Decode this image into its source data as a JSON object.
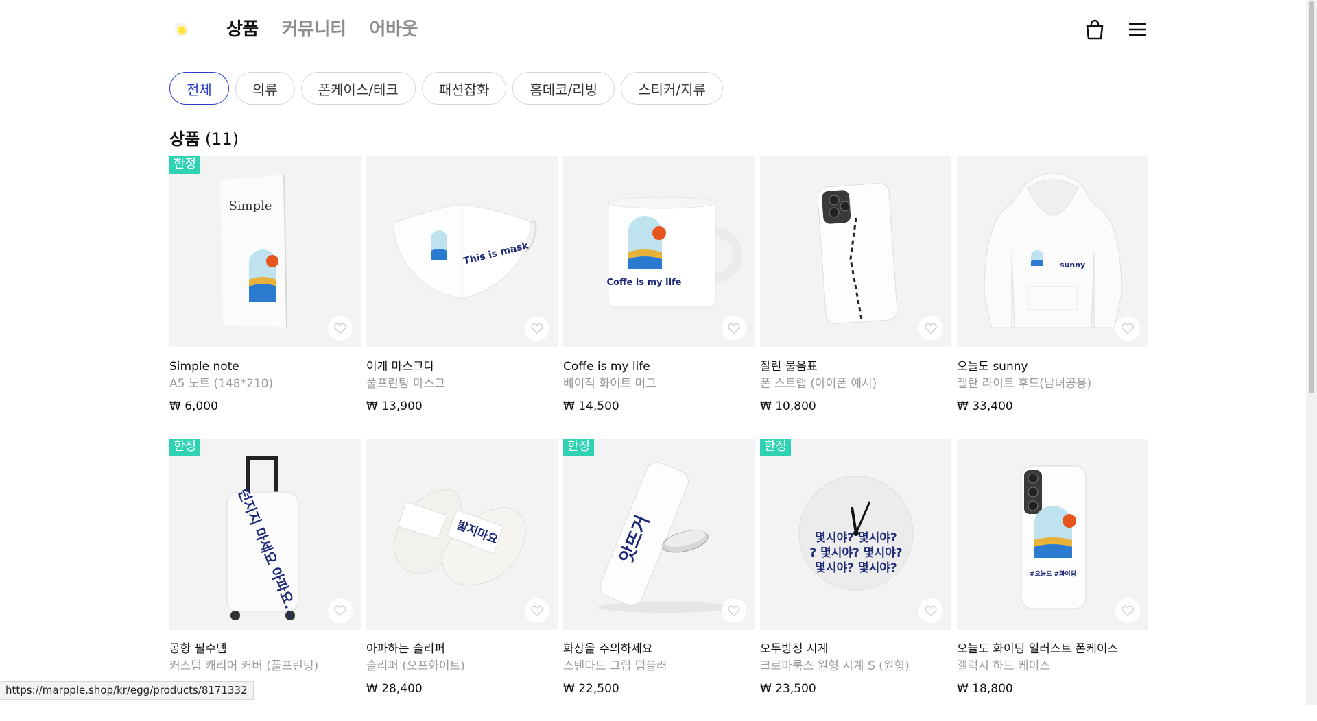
{
  "nav": {
    "items": [
      "상품",
      "커뮤니티",
      "어바웃"
    ],
    "active": "상품"
  },
  "header_icons": [
    "shopping-bag-icon",
    "menu-icon"
  ],
  "categories": [
    "전체",
    "의류",
    "폰케이스/테크",
    "패션잡화",
    "홈데코/리빙",
    "스티커/지류"
  ],
  "active_category": "전체",
  "section": {
    "title": "상품",
    "count": "(11)"
  },
  "products": [
    {
      "badge": "한정",
      "name": "Simple note",
      "sub": "A5 노트 (148*210)",
      "price": "₩ 6,000",
      "art_text": "Simple"
    },
    {
      "badge": "",
      "name": "이게 마스크다",
      "sub": "풀프린팅 마스크",
      "price": "₩ 13,900",
      "art_text": "This is mask"
    },
    {
      "badge": "",
      "name": "Coffe is my life",
      "sub": "베이직 화이트 머그",
      "price": "₩ 14,500",
      "art_text": "Coffe is my life"
    },
    {
      "badge": "",
      "name": "잘린 물음표",
      "sub": "폰 스트랩 (아이폰 예시)",
      "price": "₩ 10,800",
      "art_text": ""
    },
    {
      "badge": "",
      "name": "오늘도 sunny",
      "sub": "젤란 라이트 후드(남녀공용)",
      "price": "₩ 33,400",
      "art_text": "sunny"
    },
    {
      "badge": "한정",
      "name": "공항 필수템",
      "sub": "커스텀 캐리어 커버 (풀프린팅)",
      "price": "",
      "art_text": "던지지 마세요 아파요..."
    },
    {
      "badge": "",
      "name": "아파하는 슬리퍼",
      "sub": "슬리퍼 (오프화이트)",
      "price": "₩ 28,400",
      "art_text": "밟지마요"
    },
    {
      "badge": "한정",
      "name": "화상을 주의하세요",
      "sub": "스탠다드 그립 텀블러",
      "price": "₩ 22,500",
      "art_text": "앗뜨거"
    },
    {
      "badge": "한정",
      "name": "오두방정 시계",
      "sub": "크로마룩스 원형 시계 S (원형)",
      "price": "₩ 23,500",
      "art_text": "몇시야? 몇시야?"
    },
    {
      "badge": "",
      "name": "오늘도 화이팅 일러스트 폰케이스",
      "sub": "갤럭시 하드 케이스",
      "price": "₩ 18,800",
      "art_text": "#오늘도 #화이팅"
    }
  ],
  "status_url": "https://marpple.shop/kr/egg/products/8171332",
  "colors": {
    "accent": "#2b3fc9",
    "badge": "#2fd3b4",
    "navy": "#1e2a78"
  }
}
